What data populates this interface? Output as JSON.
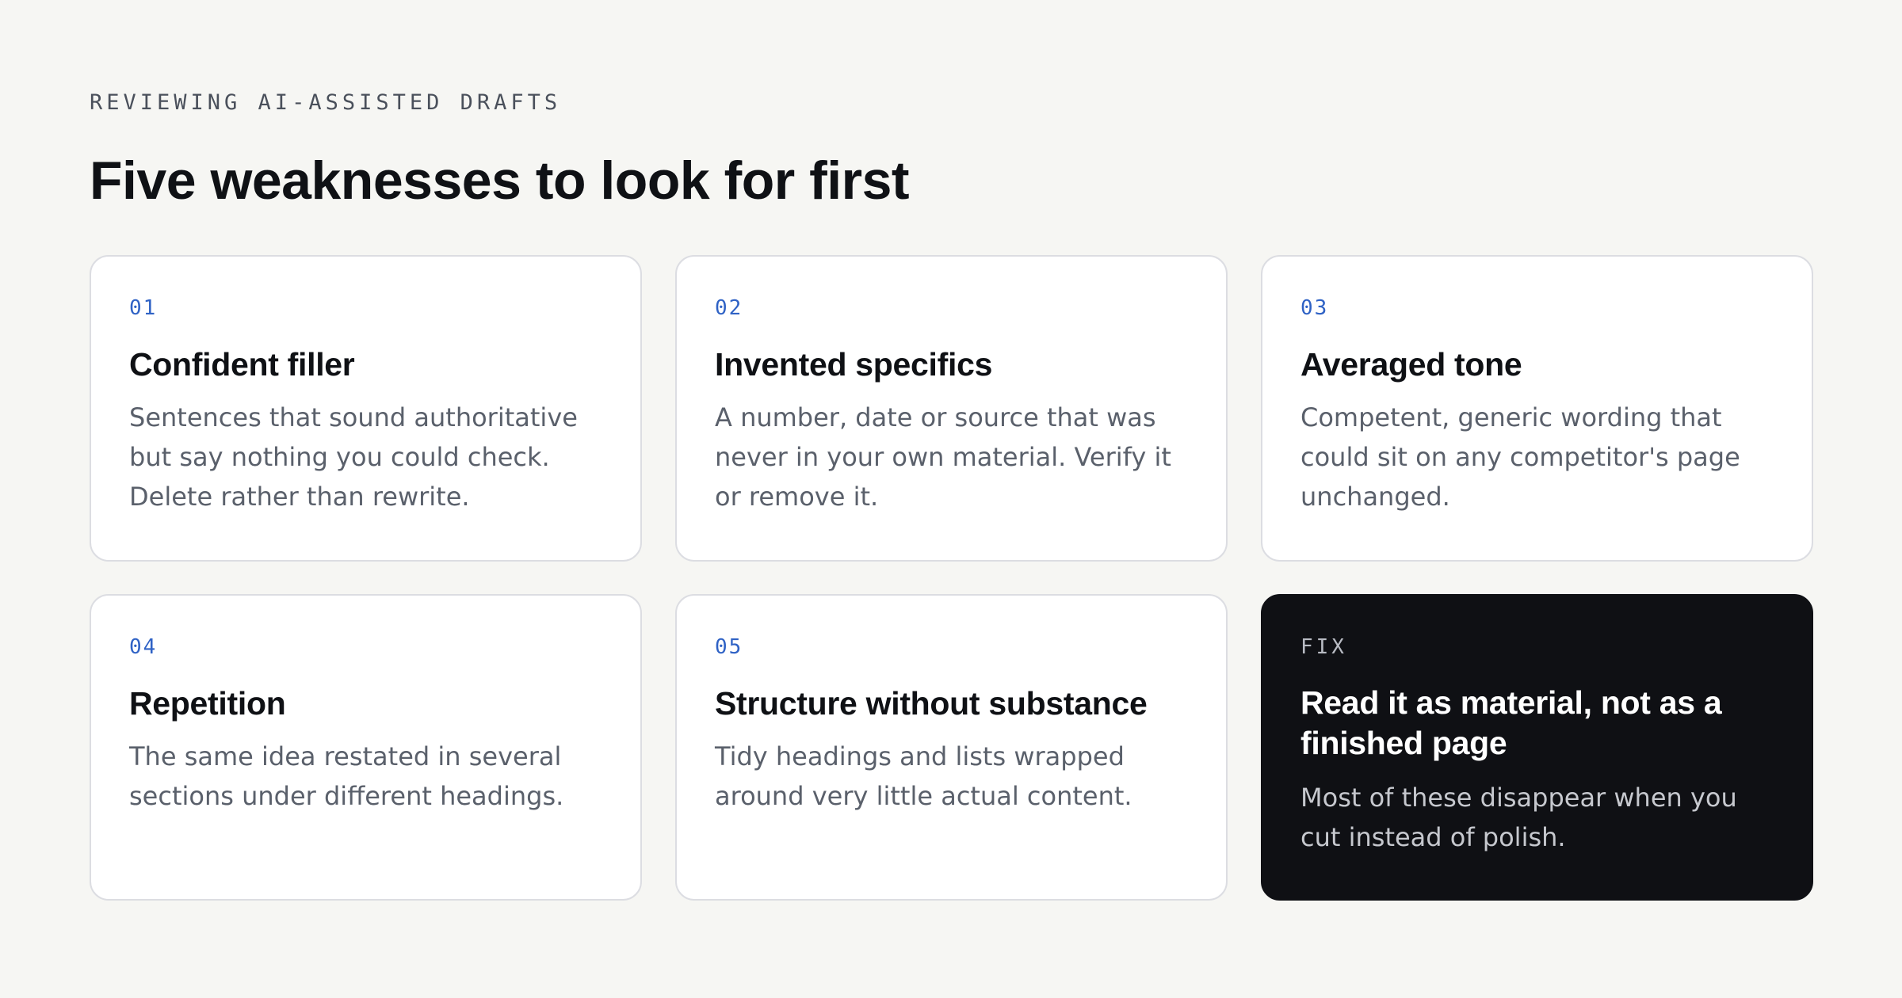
{
  "header": {
    "eyebrow": "REVIEWING AI-ASSISTED DRAFTS",
    "title": "Five weaknesses to look for first"
  },
  "cards": [
    {
      "number": "01",
      "title": "Confident filler",
      "body": "Sentences that sound authoritative but say nothing you could check. Delete rather than rewrite."
    },
    {
      "number": "02",
      "title": "Invented specifics",
      "body": "A number, date or source that was never in your own material. Verify it or remove it."
    },
    {
      "number": "03",
      "title": "Averaged tone",
      "body": "Competent, generic wording that could sit on any competitor's page unchanged."
    },
    {
      "number": "04",
      "title": "Repetition",
      "body": "The same idea restated in several sections under different headings."
    },
    {
      "number": "05",
      "title": "Structure without substance",
      "body": "Tidy headings and lists wrapped around very little actual content."
    }
  ],
  "fix_card": {
    "label": "FIX",
    "title": "Read it as material, not as a finished page",
    "body": "Most of these disappear when you cut instead of polish."
  },
  "colors": {
    "background": "#f6f6f3",
    "accent_number": "#2f62c5",
    "card_background": "#ffffff",
    "dark_card_background": "#0f1014"
  }
}
